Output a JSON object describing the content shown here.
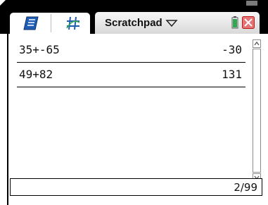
{
  "header": {
    "title": "Scratchpad",
    "tabs": [
      {
        "name": "calculator",
        "icon": "calculator-tab-icon"
      },
      {
        "name": "graphs",
        "icon": "graphs-tab-icon"
      }
    ]
  },
  "history": [
    {
      "expression": "35+-65",
      "result": "-30"
    },
    {
      "expression": "49+82",
      "result": "131"
    }
  ],
  "status": {
    "entry_count": "2/99"
  },
  "colors": {
    "frame": "#000000",
    "title_gradient_top": "#f7f7f7",
    "title_gradient_bottom": "#d9d9d9",
    "calc_icon_blue": "#1f5db5",
    "close_red": "#d32f2f",
    "battery_green": "#2fa84f"
  }
}
